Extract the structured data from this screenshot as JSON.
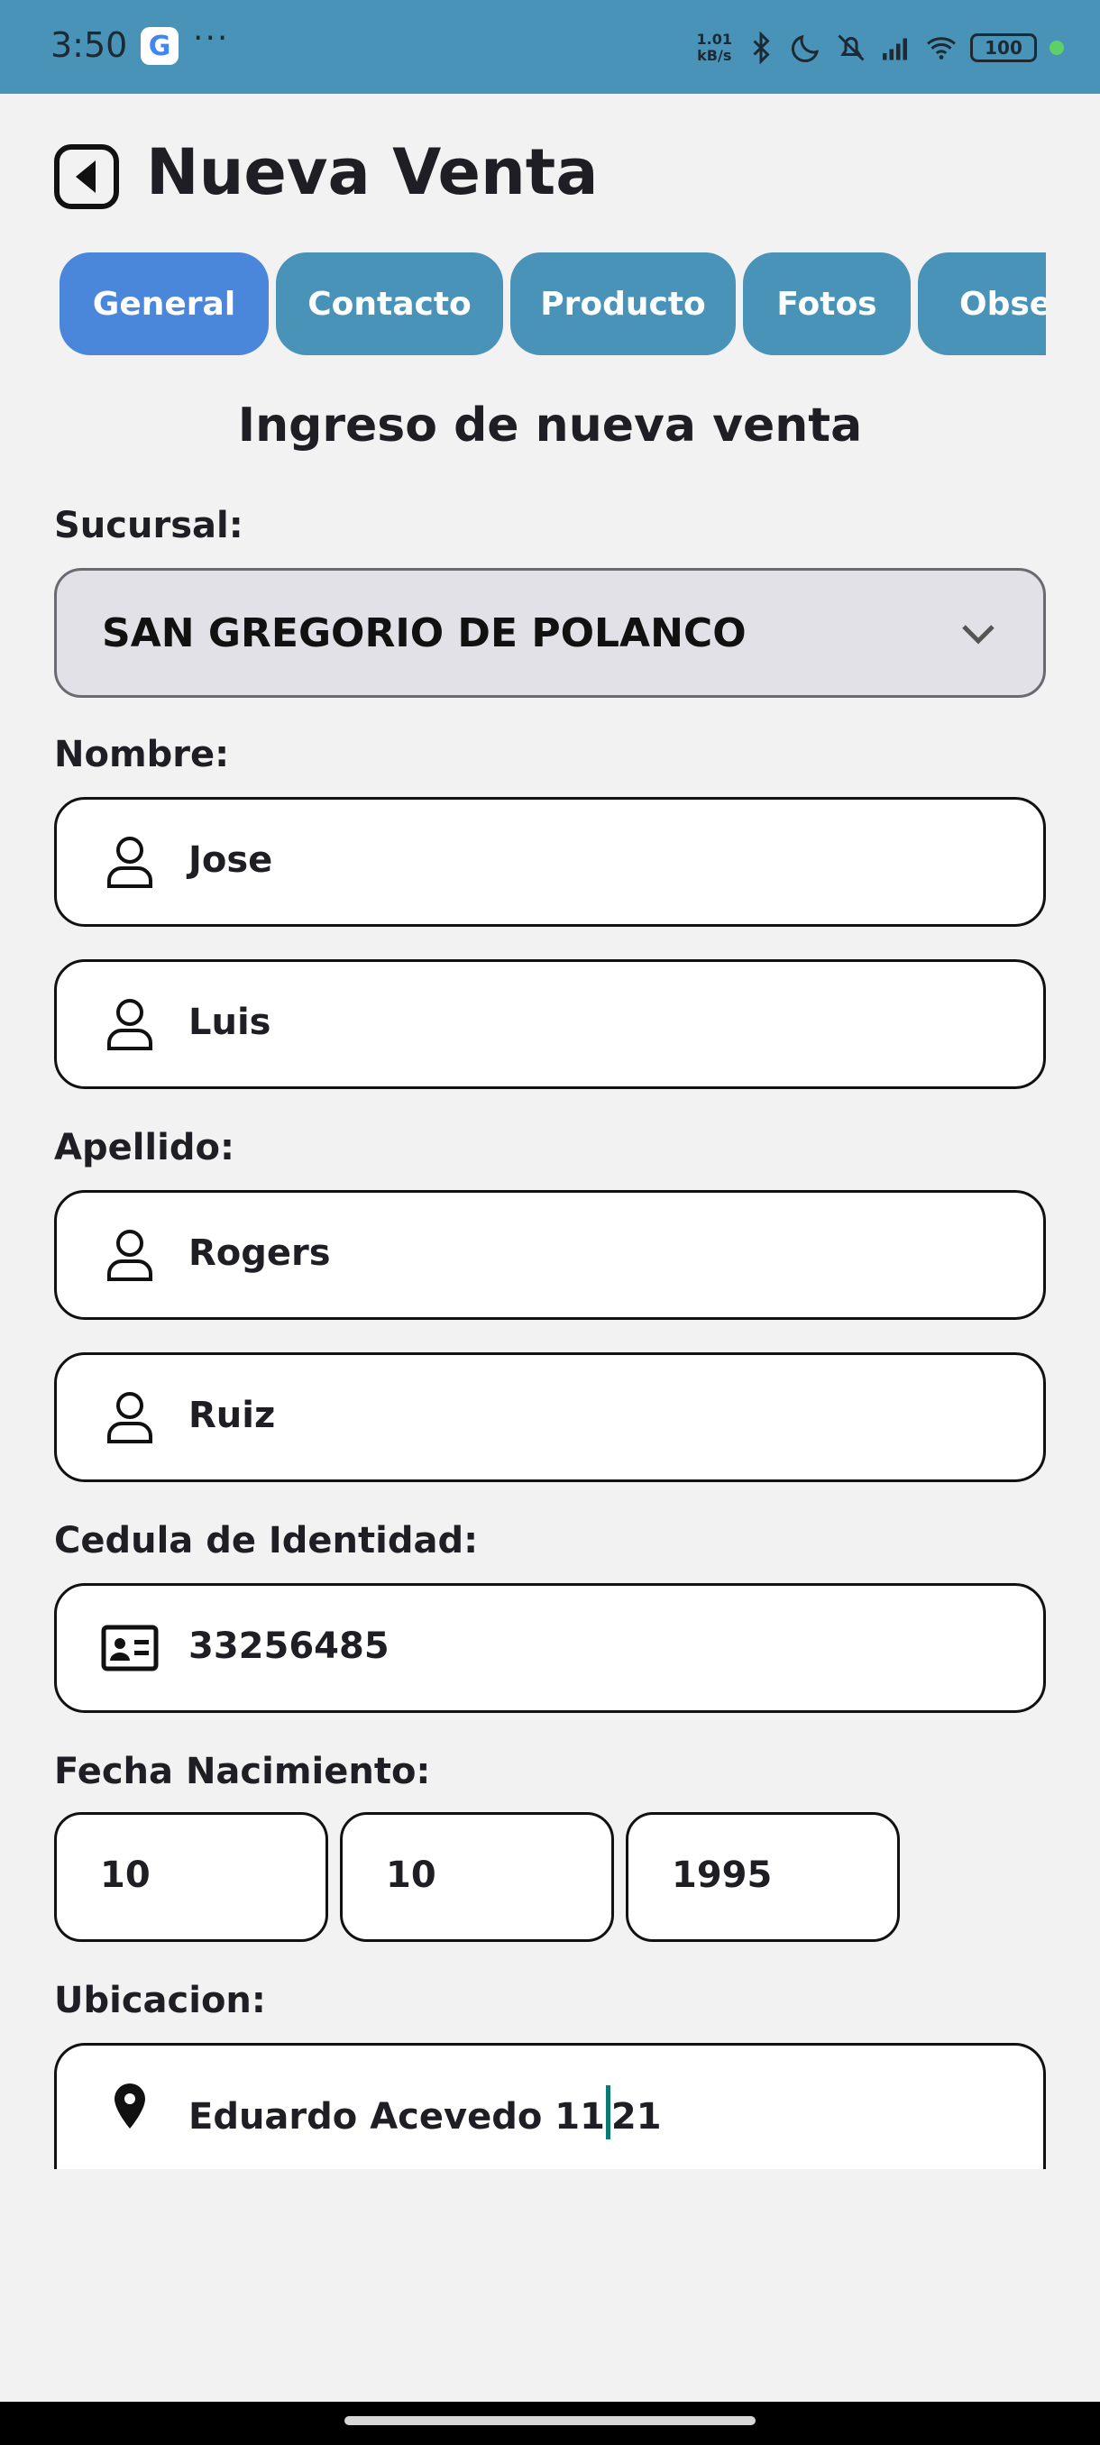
{
  "status_bar": {
    "time": "3:50",
    "dots": "···",
    "net_speed_value": "1.01",
    "net_speed_unit": "kB/s",
    "battery": "100"
  },
  "header": {
    "title": "Nueva Venta"
  },
  "tabs": [
    {
      "label": "General"
    },
    {
      "label": "Contacto"
    },
    {
      "label": "Producto"
    },
    {
      "label": "Fotos"
    },
    {
      "label": "Obser"
    }
  ],
  "form": {
    "section_title": "Ingreso de nueva venta",
    "sucursal_label": "Sucursal:",
    "sucursal_value": "SAN GREGORIO DE POLANCO",
    "nombre_label": "Nombre:",
    "nombre_1": "Jose",
    "nombre_2": "Luis",
    "apellido_label": "Apellido:",
    "apellido_1": "Rogers",
    "apellido_2": "Ruiz",
    "cedula_label": "Cedula de Identidad:",
    "cedula_value": "33256485",
    "fecha_label": "Fecha Nacimiento:",
    "fecha_dia": "10",
    "fecha_mes": "10",
    "fecha_anio": "1995",
    "ubicacion_label": "Ubicacion:",
    "ubicacion_before_cursor": "Eduardo Acevedo 11",
    "ubicacion_after_cursor": "21"
  },
  "colors": {
    "status_bar_bg": "#4a93b8",
    "tab_bg": "#4a93b8",
    "tab_active_bg": "#4a86d9",
    "select_bg": "#e3e1e8",
    "cursor": "#0b7a72"
  },
  "icons": {
    "back": "back-arrow-icon",
    "person": "person-icon",
    "id_card": "id-card-icon",
    "location": "location-pin-icon",
    "dropdown": "chevron-down-icon"
  }
}
